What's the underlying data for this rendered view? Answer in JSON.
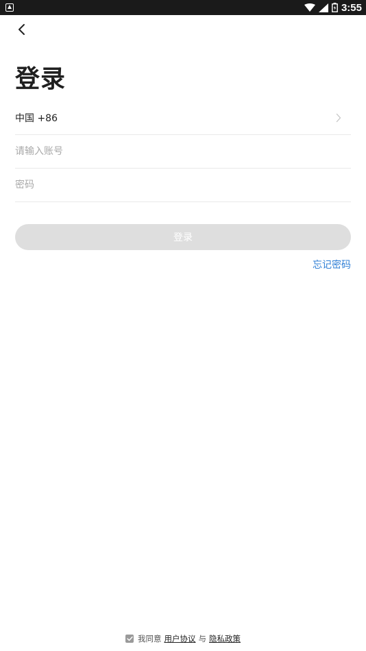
{
  "status_bar": {
    "time": "3:55"
  },
  "header": {
    "title": "登录"
  },
  "form": {
    "country_code": "中国 +86",
    "account_placeholder": "请输入账号",
    "password_placeholder": "密码",
    "login_label": "登录",
    "forgot_password": "忘记密码"
  },
  "agreement": {
    "prefix": "我同意",
    "user_agreement": "用户协议",
    "and": "与",
    "privacy_policy": "隐私政策"
  },
  "colors": {
    "accent": "#2f7fd6",
    "button_disabled": "#dedede",
    "status_bar": "#1a1a1a"
  }
}
